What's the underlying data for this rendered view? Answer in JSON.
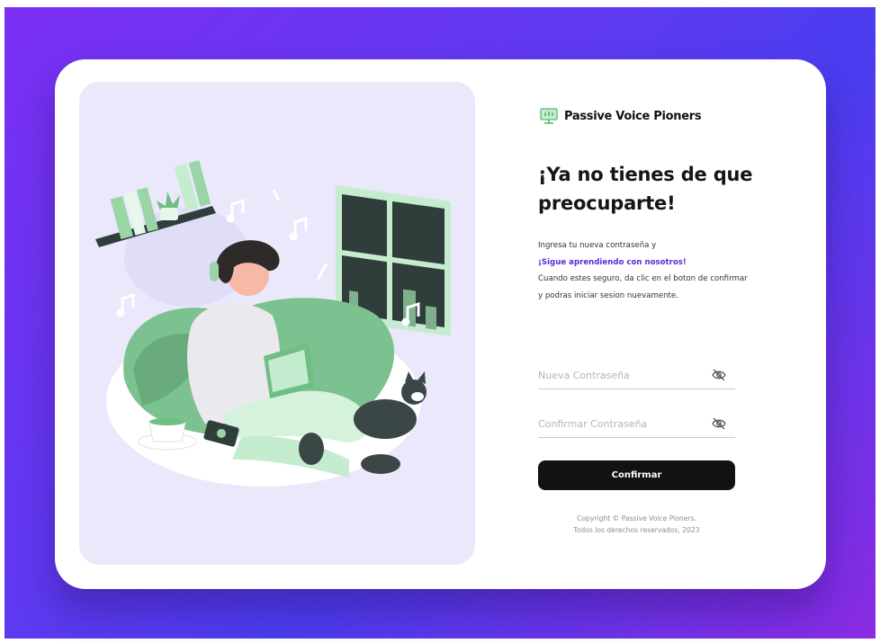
{
  "brand": {
    "name": "Passive Voice Pioners",
    "icon": "monitor-icon"
  },
  "heading": "¡Ya no tienes de que preocuparte!",
  "description": {
    "line1": "Ingresa tu nueva contraseña y",
    "highlight": "¡Sigue aprendiendo con nosotros!",
    "line2": "Cuando estes seguro, da clic en el boton de confirmar y podras iniciar sesion nuevamente."
  },
  "form": {
    "new_password": {
      "placeholder": "Nueva Contraseña",
      "value": "",
      "icon": "eye-off-icon"
    },
    "confirm_password": {
      "placeholder": "Confirmar Contraseña",
      "value": "",
      "icon": "eye-off-icon"
    },
    "submit_label": "Confirmar"
  },
  "footer": {
    "line1": "Copyright © Passive Voice Pioners.",
    "line2": "Todos los derechos reservados, 2023"
  },
  "colors": {
    "accent": "#5b2ad6",
    "button": "#121212",
    "illustration_bg": "#ebe8fc",
    "illustration_green": "#9ad5a6"
  }
}
